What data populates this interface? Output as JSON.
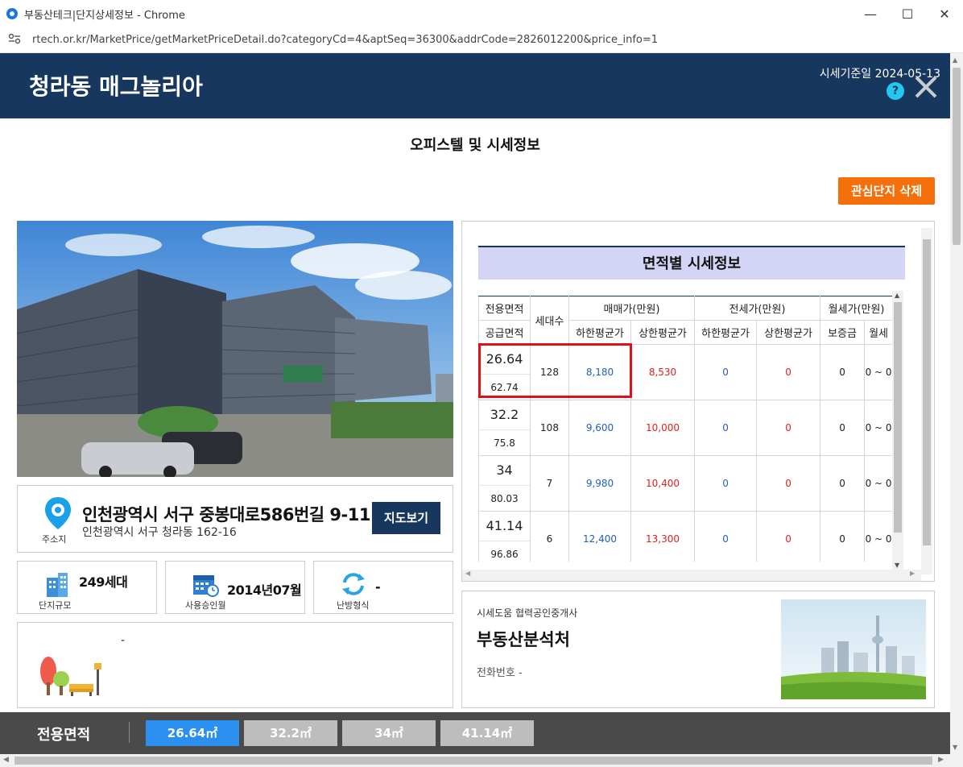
{
  "browser": {
    "title": "부동산테크|단지상세정보 - Chrome",
    "url": "rtech.or.kr/MarketPrice/getMarketPriceDetail.do?categoryCd=4&aptSeq=36300&addrCode=2826012200&price_info=1",
    "minimize": "—",
    "maximize": "☐",
    "close": "✕"
  },
  "header": {
    "complex_name": "청라동 매그놀리아",
    "price_date": "시세기준일 2024-05-13",
    "help": "?"
  },
  "section_title": "오피스텔 및 시세정보",
  "favorite_button": "관심단지 삭제",
  "address": {
    "label": "주소지",
    "road": "인천광역시 서구 중봉대로586번길 9-11",
    "jibun": "인천광역시 서구 청라동 162-16",
    "map_button": "지도보기"
  },
  "info": {
    "households_value": "249세대",
    "households_label": "단지규모",
    "approval_value": "2014년07월",
    "approval_label": "사용승인월",
    "heating_value": "-",
    "heating_label": "난방형식"
  },
  "facilities": {
    "value": "-"
  },
  "price_table": {
    "title": "면적별 시세정보",
    "headers": {
      "exclusive": "전용면적",
      "supply": "공급면적",
      "households": "세대수",
      "sale": "매매가(만원)",
      "jeonse": "전세가(만원)",
      "monthly": "월세가(만원)",
      "low": "하한평균가",
      "high": "상한평균가",
      "deposit": "보증금",
      "rent": "월세"
    },
    "rows": [
      {
        "exclusive": "26.64",
        "supply": "62.74",
        "households": "128",
        "sale_low": "8,180",
        "sale_high": "8,530",
        "jeonse_low": "0",
        "jeonse_high": "0",
        "deposit": "0",
        "rent": "0 ~ 0"
      },
      {
        "exclusive": "32.2",
        "supply": "75.8",
        "households": "108",
        "sale_low": "9,600",
        "sale_high": "10,000",
        "jeonse_low": "0",
        "jeonse_high": "0",
        "deposit": "0",
        "rent": "0 ~ 0"
      },
      {
        "exclusive": "34",
        "supply": "80.03",
        "households": "7",
        "sale_low": "9,980",
        "sale_high": "10,400",
        "jeonse_low": "0",
        "jeonse_high": "0",
        "deposit": "0",
        "rent": "0 ~ 0"
      },
      {
        "exclusive": "41.14",
        "supply": "96.86",
        "households": "6",
        "sale_low": "12,400",
        "sale_high": "13,300",
        "jeonse_low": "0",
        "jeonse_high": "0",
        "deposit": "0",
        "rent": "0 ~ 0"
      }
    ]
  },
  "agent": {
    "label": "시세도움 협력공인중개사",
    "name": "부동산분석처",
    "phone": "전화번호 -"
  },
  "area_bar": {
    "label": "전용면적",
    "tabs": [
      "26.64㎡",
      "32.2㎡",
      "34㎡",
      "41.14㎡"
    ],
    "active_index": 0
  }
}
